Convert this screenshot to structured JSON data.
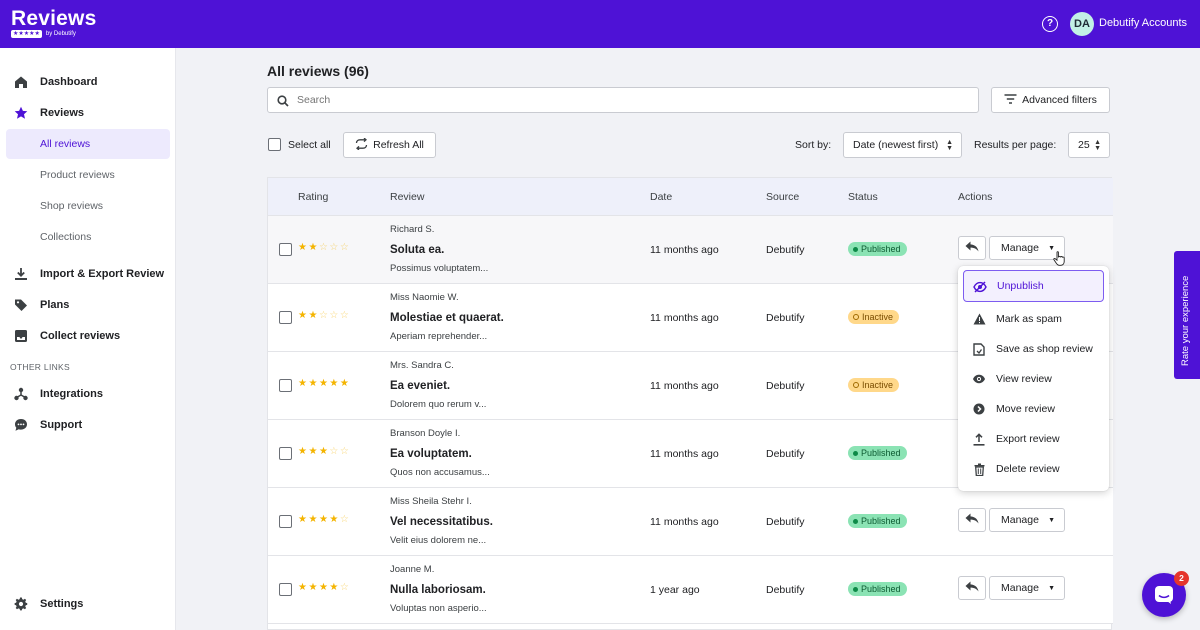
{
  "app": {
    "logo_text": "Reviews",
    "logo_stars": "★★★★★",
    "logo_by": "by Debutify",
    "account_initials": "DA",
    "account_name": "Debutify Accounts"
  },
  "sidebar": {
    "items": [
      {
        "label": "Dashboard",
        "icon": "home-icon"
      },
      {
        "label": "Reviews",
        "icon": "star-icon"
      },
      {
        "label": "Import & Export Review",
        "icon": "download-icon"
      },
      {
        "label": "Plans",
        "icon": "tag-icon"
      },
      {
        "label": "Collect reviews",
        "icon": "inbox-icon"
      },
      {
        "label": "Integrations",
        "icon": "integrations-icon"
      },
      {
        "label": "Support",
        "icon": "chat-bubble-icon"
      },
      {
        "label": "Settings",
        "icon": "gear-icon"
      }
    ],
    "sub_items": [
      "All reviews",
      "Product reviews",
      "Shop reviews",
      "Collections"
    ],
    "section_label": "OTHER LINKS"
  },
  "main": {
    "title": "All reviews (96)",
    "search_placeholder": "Search",
    "advanced_filters": "Advanced filters",
    "select_all": "Select all",
    "refresh_all": "Refresh All",
    "sort_by_label": "Sort by:",
    "sort_value": "Date (newest first)",
    "results_label": "Results per page:",
    "results_value": "25"
  },
  "table": {
    "headers": [
      "Rating",
      "Review",
      "Date",
      "Source",
      "Status",
      "Actions"
    ],
    "manage_label": "Manage",
    "rows": [
      {
        "rating": 2,
        "reviewer": "Richard S.",
        "title": "Soluta ea.",
        "body": "Possimus voluptatem...",
        "date": "11 months ago",
        "source": "Debutify",
        "status": "Published"
      },
      {
        "rating": 2,
        "reviewer": "Miss Naomie W.",
        "title": "Molestiae et quaerat.",
        "body": "Aperiam reprehender...",
        "date": "11 months ago",
        "source": "Debutify",
        "status": "Inactive"
      },
      {
        "rating": 5,
        "reviewer": "Mrs. Sandra C.",
        "title": "Ea eveniet.",
        "body": "Dolorem quo rerum v...",
        "date": "11 months ago",
        "source": "Debutify",
        "status": "Inactive"
      },
      {
        "rating": 3,
        "reviewer": "Branson Doyle I.",
        "title": "Ea voluptatem.",
        "body": "Quos non accusamus...",
        "date": "11 months ago",
        "source": "Debutify",
        "status": "Published"
      },
      {
        "rating": 4,
        "reviewer": "Miss Sheila Stehr I.",
        "title": "Vel necessitatibus.",
        "body": "Velit eius dolorem ne...",
        "date": "11 months ago",
        "source": "Debutify",
        "status": "Published"
      },
      {
        "rating": 4,
        "reviewer": "Joanne M.",
        "title": "Nulla laboriosam.",
        "body": "Voluptas non asperio...",
        "date": "1 year ago",
        "source": "Debutify",
        "status": "Published"
      }
    ]
  },
  "menu": {
    "items": [
      {
        "label": "Unpublish",
        "icon": "eye-off-icon"
      },
      {
        "label": "Mark as spam",
        "icon": "warning-icon"
      },
      {
        "label": "Save as shop review",
        "icon": "save-icon"
      },
      {
        "label": "View review",
        "icon": "eye-icon"
      },
      {
        "label": "Move review",
        "icon": "arrow-circle-icon"
      },
      {
        "label": "Export review",
        "icon": "upload-icon"
      },
      {
        "label": "Delete review",
        "icon": "trash-icon"
      }
    ]
  },
  "widgets": {
    "rate_tab": "Rate your experience",
    "chat_badge": "2"
  },
  "colors": {
    "brand": "#4e12d6",
    "published_bg": "#8be3b4",
    "inactive_bg": "#ffd88a",
    "star": "#f4b400"
  }
}
